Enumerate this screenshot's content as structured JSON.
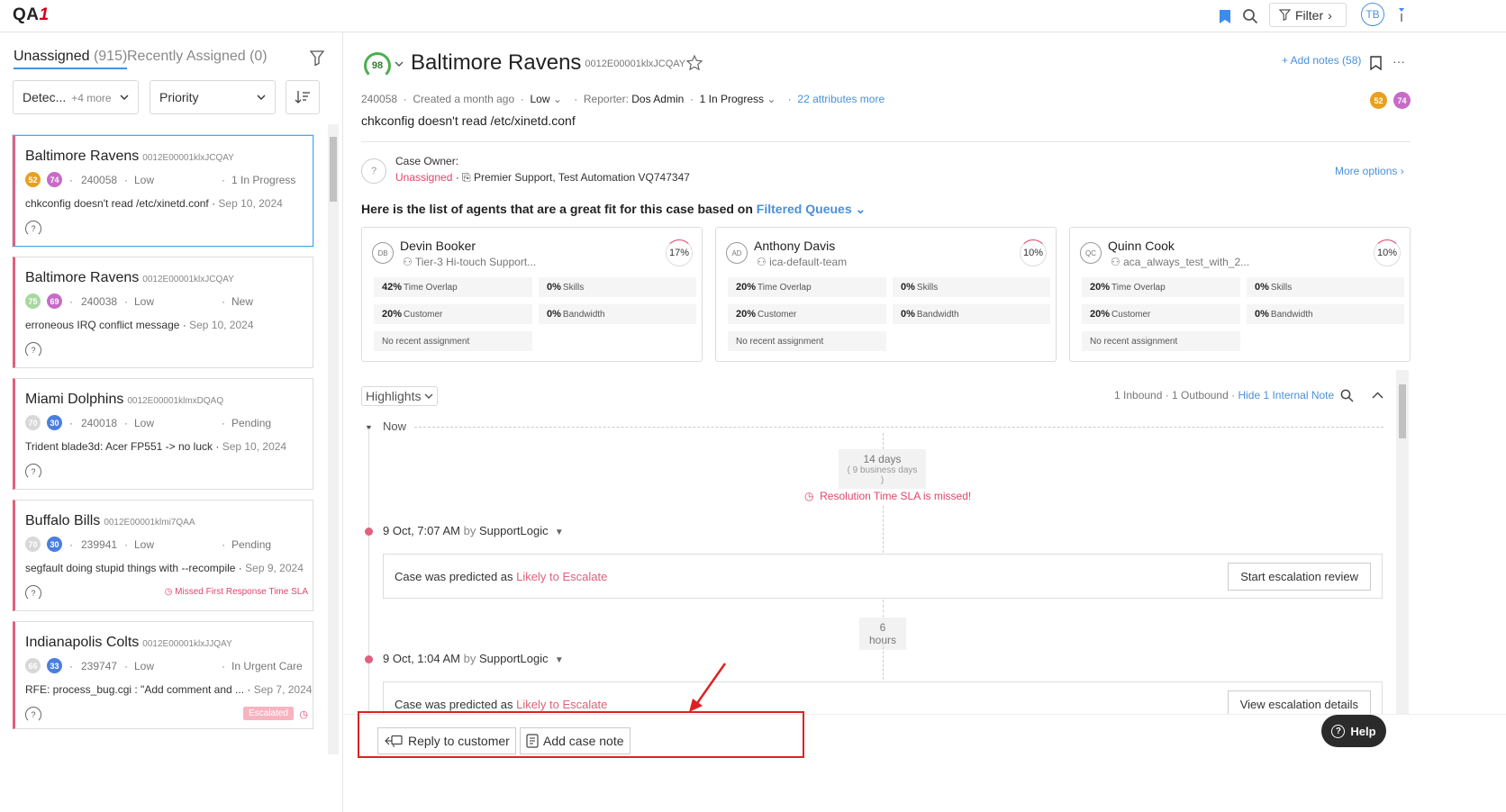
{
  "header": {
    "logo": "QA",
    "logo_suffix": "1",
    "filter_label": "Filter",
    "user_initials": "TB"
  },
  "left": {
    "tab_unassigned": "Unassigned",
    "tab_unassigned_count": "(915)",
    "tab_recent": "Recently Assigned (0)",
    "filter_detect": "Detec...",
    "filter_detect_more": "+4 more",
    "filter_priority": "Priority",
    "cards": [
      {
        "title": "Baltimore Ravens",
        "cid": "0012E00001klxJCQAY",
        "s1": "52",
        "s2": "74",
        "c1": "#e8a020",
        "c2": "#c86bc8",
        "num": "240058",
        "prio": "Low",
        "status": "1 In Progress",
        "desc": "chkconfig doesn't read /etc/xinetd.conf",
        "date": "Sep 10, 2024",
        "extra": ""
      },
      {
        "title": "Baltimore Ravens",
        "cid": "0012E00001klxJCQAY",
        "s1": "75",
        "s2": "69",
        "c1": "#a8d8a0",
        "c2": "#c86bc8",
        "num": "240038",
        "prio": "Low",
        "status": "New",
        "desc": "erroneous IRQ conflict message",
        "date": "Sep 10, 2024",
        "extra": ""
      },
      {
        "title": "Miami Dolphins",
        "cid": "0012E00001klmxDQAQ",
        "s1": "70",
        "s2": "30",
        "c1": "#d8d8d8",
        "c2": "#4a7fe0",
        "num": "240018",
        "prio": "Low",
        "status": "Pending",
        "desc": "Trident blade3d: Acer FP551 -> no luck",
        "date": "Sep 10, 2024",
        "extra": ""
      },
      {
        "title": "Buffalo Bills",
        "cid": "0012E00001klmi7QAA",
        "s1": "70",
        "s2": "30",
        "c1": "#d8d8d8",
        "c2": "#4a7fe0",
        "num": "239941",
        "prio": "Low",
        "status": "Pending",
        "desc": "segfault doing stupid things with --recompile",
        "date": "Sep 9, 2024",
        "extra": "Missed First Response Time SLA"
      },
      {
        "title": "Indianapolis Colts",
        "cid": "0012E00001klxJJQAY",
        "s1": "66",
        "s2": "33",
        "c1": "#d8d8d8",
        "c2": "#4a7fe0",
        "num": "239747",
        "prio": "Low",
        "status": "In Urgent Care",
        "desc": "RFE: process_bug.cgi : \"Add comment and ...",
        "date": "Sep 7, 2024",
        "extra": "Escalated"
      }
    ]
  },
  "case": {
    "score": "98",
    "title": "Baltimore Ravens",
    "cid": "0012E00001klxJCQAY",
    "number": "240058",
    "created": "Created a month ago",
    "priority": "Low",
    "reporter_label": "Reporter:",
    "reporter": "Dos Admin",
    "status": "1 In Progress",
    "attributes_more": "22 attributes more",
    "subject": "chkconfig doesn't read /etc/xinetd.conf",
    "add_notes": "+ Add notes (58)",
    "badge1": "52",
    "badge2": "74",
    "owner_label": "Case Owner:",
    "owner_value": "Unassigned",
    "queue": "Premier Support, Test Automation VQ747347",
    "more_options": "More options",
    "agents_heading": "Here is the list of agents that are a great fit for this case based on",
    "agents_link": "Filtered Queues"
  },
  "agents": [
    {
      "initials": "DB",
      "name": "Devin Booker",
      "team": "Tier-3 Hi-touch Support...",
      "pct": "17%",
      "time": "42%",
      "skills": "0%",
      "customer": "20%",
      "bandwidth": "0%"
    },
    {
      "initials": "AD",
      "name": "Anthony Davis",
      "team": "ica-default-team",
      "pct": "10%",
      "time": "20%",
      "skills": "0%",
      "customer": "20%",
      "bandwidth": "0%"
    },
    {
      "initials": "QC",
      "name": "Quinn Cook",
      "team": "aca_always_test_with_2...",
      "pct": "10%",
      "time": "20%",
      "skills": "0%",
      "customer": "20%",
      "bandwidth": "0%"
    }
  ],
  "agent_labels": {
    "time": "Time Overlap",
    "skills": "Skills",
    "customer": "Customer",
    "bandwidth": "Bandwidth",
    "recent": "No recent assignment"
  },
  "timeline": {
    "highlights": "Highlights",
    "io_counts": "1 Inbound · 1 Outbound ·",
    "hide_note": "Hide 1 Internal Note",
    "now": "Now",
    "gap1_main": "14 days",
    "gap1_sub": "( 9 business days )",
    "sla": "Resolution Time SLA is missed!",
    "gap2": "6 hours",
    "events": [
      {
        "time": "9 Oct, 7:07 AM",
        "by": "by",
        "author": "SupportLogic",
        "text": "Case was predicted as",
        "hl": "Likely to Escalate",
        "button": "Start escalation review"
      },
      {
        "time": "9 Oct, 1:04 AM",
        "by": "by",
        "author": "SupportLogic",
        "text": "Case was predicted as",
        "hl": "Likely to Escalate",
        "button": "View escalation details"
      }
    ]
  },
  "actions": {
    "reply": "Reply to customer",
    "note": "Add case note",
    "help": "Help"
  },
  "colors": {
    "accent": "#4a90d9",
    "alert": "#e0466a",
    "annotation": "#dd2222"
  }
}
